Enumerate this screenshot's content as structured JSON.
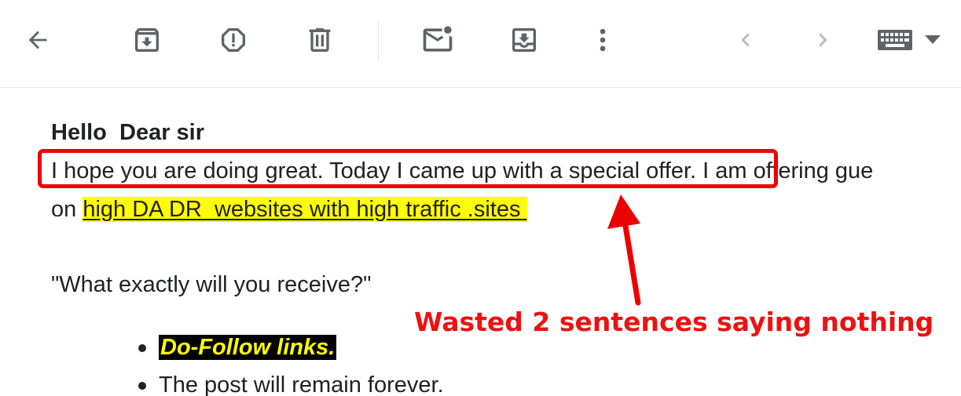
{
  "toolbar": {
    "icons": [
      "back-arrow-icon",
      "archive-icon",
      "report-spam-icon",
      "trash-icon",
      "mark-unread-icon",
      "move-to-icon",
      "more-vert-icon",
      "prev-chevron-icon",
      "next-chevron-icon",
      "keyboard-icon",
      "dropdown-caret-icon"
    ]
  },
  "email": {
    "greeting": "Hello  Dear sir",
    "line1_boxed": "I hope you are doing great. Today I came up with a special offer.",
    "line1_rest": " I am offering gue",
    "line2_prefix": "on ",
    "line2_link": "high DA DR  websites with high traffic .sites ",
    "question": "\"What exactly will you receive?\"",
    "bullets": [
      "Do-Follow links.",
      "The post will remain forever."
    ]
  },
  "annotation": {
    "text": "Wasted 2 sentences saying nothing",
    "color": "#ee1111"
  },
  "colors": {
    "highlight": "#ffff00",
    "annotation_red": "#ee0000",
    "text": "#202124"
  }
}
